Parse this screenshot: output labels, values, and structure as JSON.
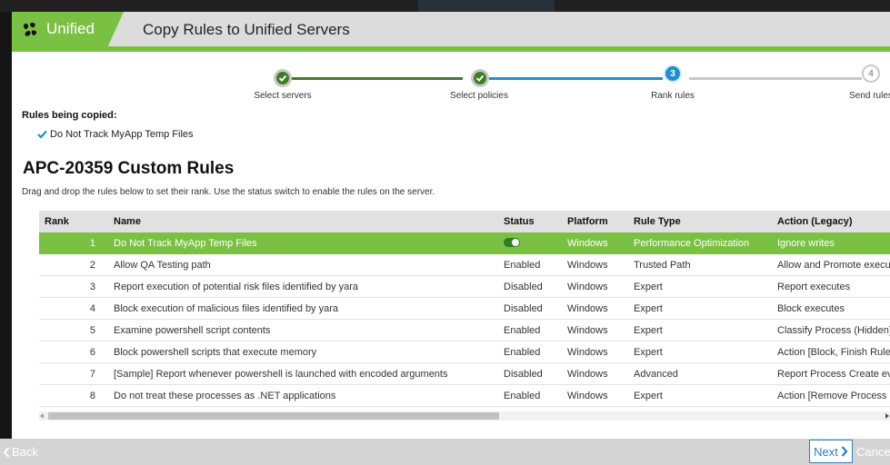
{
  "app": {
    "brand": "Unified",
    "dialog_title": "Copy Rules to Unified Servers"
  },
  "wizard": {
    "steps": [
      {
        "label": "Select servers",
        "state": "done"
      },
      {
        "label": "Select policies",
        "state": "done"
      },
      {
        "number": "3",
        "label": "Rank rules",
        "state": "current"
      },
      {
        "number": "4",
        "label": "Send rules",
        "state": "future"
      }
    ]
  },
  "copied": {
    "label": "Rules being copied:",
    "items": [
      "Do Not Track MyApp Temp Files"
    ]
  },
  "section": {
    "title": "APC-20359 Custom Rules",
    "instructions": "Drag and drop the rules below to set their rank. Use the status switch to enable the rules on the server."
  },
  "table": {
    "columns": [
      "Rank",
      "Name",
      "Status",
      "Platform",
      "Rule Type",
      "Action (Legacy)"
    ],
    "rows": [
      {
        "rank": "1",
        "name": "Do Not Track MyApp Temp Files",
        "status": "",
        "status_toggle_on": true,
        "platform": "Windows",
        "rule_type": "Performance Optimization",
        "action": "Ignore writes",
        "selected": true
      },
      {
        "rank": "2",
        "name": "Allow QA Testing path",
        "status": "Enabled",
        "platform": "Windows",
        "rule_type": "Trusted Path",
        "action": "Allow and Promote executions"
      },
      {
        "rank": "3",
        "name": "Report execution of potential risk files identified by yara",
        "status": "Disabled",
        "platform": "Windows",
        "rule_type": "Expert",
        "action": "Report executes"
      },
      {
        "rank": "4",
        "name": "Block execution of malicious files identified by yara",
        "status": "Disabled",
        "platform": "Windows",
        "rule_type": "Expert",
        "action": "Block executes"
      },
      {
        "rank": "5",
        "name": "Examine powershell script contents",
        "status": "Enabled",
        "platform": "Windows",
        "rule_type": "Expert",
        "action": "Classify Process (Hidden)"
      },
      {
        "rank": "6",
        "name": "Block powershell scripts that execute memory",
        "status": "Enabled",
        "platform": "Windows",
        "rule_type": "Expert",
        "action": "Action [Block, Finish Rule]"
      },
      {
        "rank": "7",
        "name": "[Sample] Report whenever powershell is launched with encoded arguments",
        "status": "Disabled",
        "platform": "Windows",
        "rule_type": "Advanced",
        "action": "Report Process Create events"
      },
      {
        "rank": "8",
        "name": "Do not treat these processes as .NET applications",
        "status": "Enabled",
        "platform": "Windows",
        "rule_type": "Expert",
        "action": "Action [Remove Process"
      }
    ]
  },
  "footer": {
    "back": "Back",
    "next": "Next",
    "cancel": "Cancel"
  },
  "colors": {
    "accent_green": "#7ac143",
    "done_green": "#3e7d26",
    "current_blue": "#1f8fd0",
    "link_blue": "#2a7ec0"
  },
  "icons": {
    "brand": "unified-logo-icon",
    "check": "checkmark-icon",
    "back": "chevron-left-icon",
    "next": "chevron-right-icon"
  }
}
